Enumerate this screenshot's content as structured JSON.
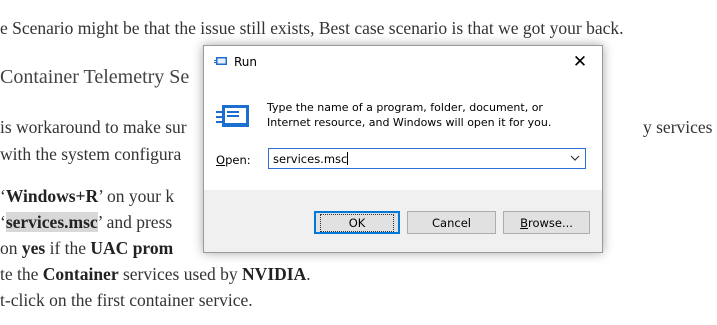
{
  "article": {
    "l1": "e Scenario might be that the issue still exists, Best case scenario is that we got your back.",
    "h": "Container Telemetry Se",
    "l3a": "is workaround to make sur",
    "l3b": "y services",
    "l4": " with the system configura",
    "l5a": "‘",
    "l5b": "Windows+R",
    "l5c": "’ on your k",
    "l6a": "‘",
    "l6b": "services.msc",
    "l6c": "’ and press",
    "l7a": " on ",
    "l7b": "yes",
    "l7c": " if the ",
    "l7d": "UAC prom",
    "l8a": "te the ",
    "l8b": "Container",
    "l8c": " services used by ",
    "l8d": "NVIDIA",
    "l8e": ".",
    "l9": "t-click on the first container service."
  },
  "dialog": {
    "title": "Run",
    "close_glyph": "✕",
    "description": "Type the name of a program, folder, document, or Internet resource, and Windows will open it for you.",
    "open_label_underlined": "O",
    "open_label_rest": "pen:",
    "input_value": "services.msc",
    "dropdown_glyph": "chevron-down-icon",
    "ok_label": "OK",
    "cancel_label": "Cancel",
    "browse_label_underlined": "B",
    "browse_label_rest": "rowse..."
  },
  "colors": {
    "accent": "#0078d7",
    "footer_bg": "#f0f0f0",
    "text": "#333333"
  }
}
